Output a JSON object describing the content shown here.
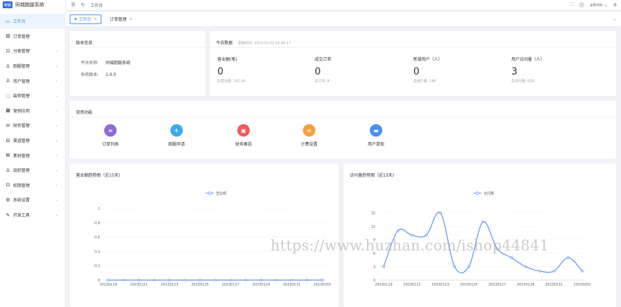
{
  "app": {
    "logo_badge": "跑腿",
    "title": "同城跑腿系统"
  },
  "sidebar": {
    "items": [
      {
        "label": "工作台",
        "icon": "monitor-icon",
        "glyph": "▭",
        "active": true,
        "expand": false
      },
      {
        "label": "订单管理",
        "icon": "document-icon",
        "glyph": "▤",
        "active": false,
        "expand": false
      },
      {
        "label": "分类管理",
        "icon": "lock-icon",
        "glyph": "⊡",
        "active": false,
        "expand": true
      },
      {
        "label": "跑腿管理",
        "icon": "user-icon",
        "glyph": "♙",
        "active": false,
        "expand": true
      },
      {
        "label": "用户管理",
        "icon": "users-icon",
        "glyph": "♙",
        "active": false,
        "expand": true
      },
      {
        "label": "装修管理",
        "icon": "location-icon",
        "glyph": "◌",
        "active": false,
        "expand": true
      },
      {
        "label": "营销应用",
        "icon": "grid-icon",
        "glyph": "▦",
        "active": false,
        "expand": true
      },
      {
        "label": "财务管理",
        "icon": "wallet-icon",
        "glyph": "⊖",
        "active": false,
        "expand": true
      },
      {
        "label": "渠道管理",
        "icon": "channel-icon",
        "glyph": "⊟",
        "active": false,
        "expand": true
      },
      {
        "label": "素材管理",
        "icon": "picture-icon",
        "glyph": "⊠",
        "active": false,
        "expand": true
      },
      {
        "label": "组织管理",
        "icon": "org-icon",
        "glyph": "♙",
        "active": false,
        "expand": true
      },
      {
        "label": "权限管理",
        "icon": "lock-icon",
        "glyph": "⊡",
        "active": false,
        "expand": true
      },
      {
        "label": "系统设置",
        "icon": "settings-icon",
        "glyph": "⚙",
        "active": false,
        "expand": true
      },
      {
        "label": "开发工具",
        "icon": "tool-icon",
        "glyph": "✎",
        "active": false,
        "expand": true
      }
    ]
  },
  "header": {
    "breadcrumb": "工作台",
    "username": "admin"
  },
  "tags": [
    {
      "label": "工作台",
      "active": true
    },
    {
      "label": "订单管理",
      "active": false
    }
  ],
  "sysinfo": {
    "title": "版本信息",
    "platform_key": "平台名称:",
    "platform_val": "同城跑腿系统",
    "version_key": "系统版本:",
    "version_val": "1.0.0"
  },
  "today": {
    "title": "今日数据",
    "updated": "更新时间: 2023-02-02 10:49:17",
    "stats": [
      {
        "label": "营业额(笔)",
        "value": "0",
        "total": "总营业额: 141.94"
      },
      {
        "label": "成交订单",
        "value": "0",
        "total": "总订单: 8"
      },
      {
        "label": "新增用户（人）",
        "value": "0",
        "total": "总用户量: 184"
      },
      {
        "label": "用户访问量（人）",
        "value": "3",
        "total": "总访问量: 629"
      }
    ]
  },
  "shortcuts": {
    "title": "常用功能",
    "items": [
      {
        "label": "订单列表",
        "icon": "order-list-icon",
        "glyph": "≡",
        "color": "#8e6bd9"
      },
      {
        "label": "跑腿申请",
        "icon": "runner-icon",
        "glyph": "✈",
        "color": "#3ba9f0"
      },
      {
        "label": "财务概括",
        "icon": "finance-icon",
        "glyph": "▣",
        "color": "#f05a5a"
      },
      {
        "label": "计费设置",
        "icon": "billing-icon",
        "glyph": "≡",
        "color": "#f5a03c"
      },
      {
        "label": "用户提现",
        "icon": "withdraw-icon",
        "glyph": "▬",
        "color": "#4a8ff0"
      }
    ]
  },
  "chart_data": [
    {
      "type": "line",
      "title": "营业额趋势图（近15天)",
      "series": [
        {
          "name": "营业额",
          "values": [
            0,
            0,
            0,
            0,
            0,
            0,
            0,
            0,
            0,
            0,
            0,
            0,
            0,
            0,
            0
          ]
        }
      ],
      "x_ticks": [
        "20230119",
        "20230121",
        "20230123",
        "20230125",
        "20230127",
        "20230129",
        "20230131",
        "20230202"
      ],
      "ylim": [
        0,
        1
      ],
      "y_ticks": [
        "0",
        "0.2",
        "0.4",
        "0.6",
        "0.8",
        "1"
      ],
      "grid": true,
      "legend": "top-center",
      "color": "#5b8ff9"
    },
    {
      "type": "line",
      "title": "访问量趋势图（近15天)",
      "series": [
        {
          "name": "访问量",
          "values": [
            3,
            11,
            10,
            10,
            15,
            3,
            3,
            13,
            7,
            5,
            3,
            2,
            2,
            5,
            2
          ]
        }
      ],
      "x_ticks": [
        "20230119",
        "20230121",
        "20230123",
        "20230125",
        "20230127",
        "20230129",
        "20230131",
        "20230202"
      ],
      "ylim": [
        0,
        16
      ],
      "y_ticks": [
        "0",
        "3",
        "6",
        "9",
        "12",
        "15"
      ],
      "grid": true,
      "legend": "top-center",
      "color": "#5b8ff9"
    }
  ],
  "watermark": "https://www.huzhan.com/ishop44841"
}
